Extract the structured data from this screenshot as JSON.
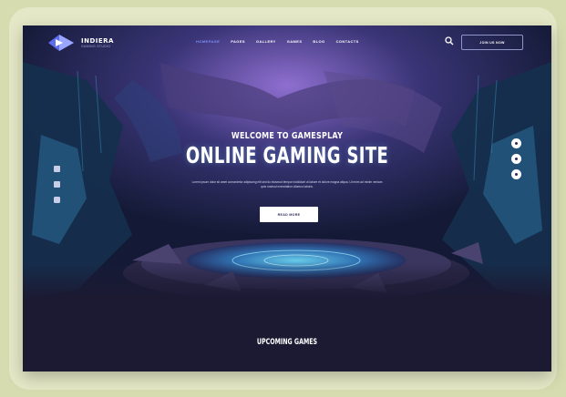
{
  "brand": {
    "name": "INDIERA",
    "tagline": "GAMING STUDIO"
  },
  "nav": {
    "items": [
      {
        "label": "HOMEPAGE",
        "active": true
      },
      {
        "label": "PAGES",
        "active": false
      },
      {
        "label": "GALLERY",
        "active": false
      },
      {
        "label": "GAMES",
        "active": false
      },
      {
        "label": "BLOG",
        "active": false
      },
      {
        "label": "CONTACTS",
        "active": false
      }
    ],
    "search_icon": "search-icon",
    "button_label": "JOIN US NOW"
  },
  "hero": {
    "subtitle": "WELCOME TO GAMESPLAY",
    "title": "ONLINE GAMING SITE",
    "description": "Lorem ipsum dolor sit amet consectetur adipiscing elit sed do eiusmod tempor incididunt ut labore et dolore magna aliqua. Ut enim ad minim veniam quis nostrud exercitation ullamco laboris.",
    "cta_label": "READ MORE",
    "social_icons": [
      "facebook-icon",
      "twitter-icon",
      "instagram-icon"
    ],
    "slider_dots": 3
  },
  "section": {
    "title": "UPCOMING GAMES"
  },
  "colors": {
    "page_bg": "#d6dbb0",
    "site_bg": "#1c1a33",
    "accent": "#7c8fff",
    "cyan_glow": "#3fb7e8"
  }
}
